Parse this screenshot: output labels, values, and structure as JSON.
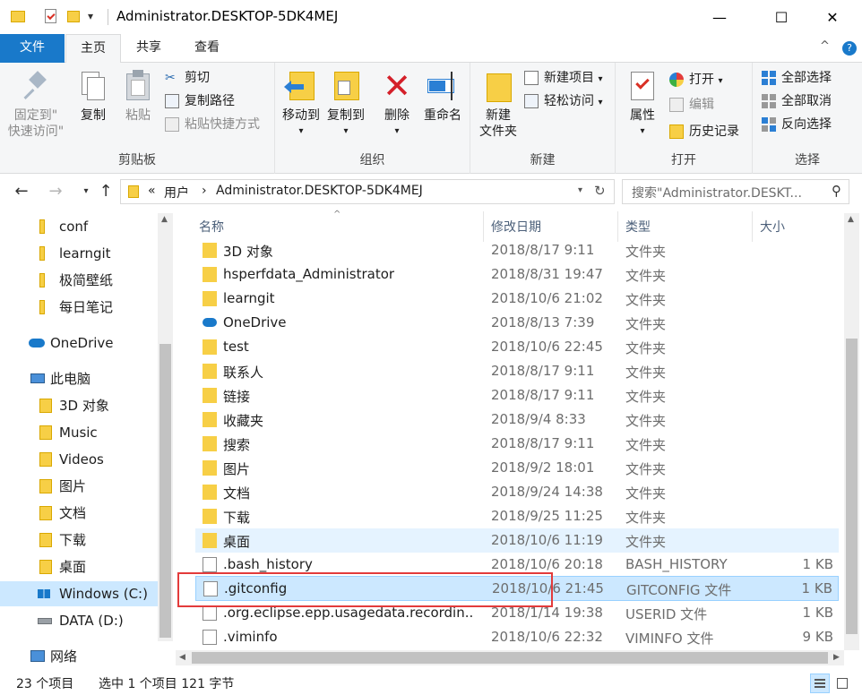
{
  "window": {
    "title": "Administrator.DESKTOP-5DK4MEJ",
    "minimize": "—",
    "maximize": "☐",
    "close": "✕",
    "qat_dropdown": "▾"
  },
  "ribbon_tabs": {
    "file": "文件",
    "home": "主页",
    "share": "共享",
    "view": "查看",
    "collapse": "^",
    "help": "?"
  },
  "ribbon": {
    "clipboard": {
      "label": "剪贴板",
      "pin": [
        "固定到\"",
        "快速访问\""
      ],
      "copy": "复制",
      "paste": "粘贴",
      "cut": "剪切",
      "copy_path": "复制路径",
      "paste_shortcut": "粘贴快捷方式"
    },
    "organize": {
      "label": "组织",
      "move_to": "移动到",
      "copy_to": "复制到",
      "delete": "删除",
      "rename": "重命名"
    },
    "new": {
      "label": "新建",
      "new_folder": [
        "新建",
        "文件夹"
      ],
      "new_item": "新建项目",
      "easy_access": "轻松访问"
    },
    "open": {
      "label": "打开",
      "properties": "属性",
      "open": "打开",
      "edit": "编辑",
      "history": "历史记录"
    },
    "select": {
      "label": "选择",
      "select_all": "全部选择",
      "select_none": "全部取消",
      "invert": "反向选择"
    }
  },
  "address": {
    "breadcrumb_prefix": "«",
    "crumb1": "用户",
    "sep": "›",
    "crumb2": "Administrator.DESKTOP-5DK4MEJ",
    "search_placeholder": "搜索\"Administrator.DESKT..."
  },
  "nav_pane": {
    "items": [
      {
        "label": "conf",
        "icon": "folder-icon"
      },
      {
        "label": "learngit",
        "icon": "folder-icon"
      },
      {
        "label": "极简壁纸",
        "icon": "folder-icon"
      },
      {
        "label": "每日笔记",
        "icon": "folder-icon"
      },
      {
        "label": "OneDrive",
        "icon": "onedrive-icon"
      },
      {
        "label": "此电脑",
        "icon": "computer-icon"
      },
      {
        "label": "3D 对象",
        "icon": "3d-objects-icon"
      },
      {
        "label": "Music",
        "icon": "music-icon"
      },
      {
        "label": "Videos",
        "icon": "videos-icon"
      },
      {
        "label": "图片",
        "icon": "pictures-icon"
      },
      {
        "label": "文档",
        "icon": "documents-icon"
      },
      {
        "label": "下载",
        "icon": "downloads-icon"
      },
      {
        "label": "桌面",
        "icon": "desktop-icon"
      },
      {
        "label": "Windows (C:)",
        "icon": "windows-drive-icon"
      },
      {
        "label": "DATA (D:)",
        "icon": "drive-icon"
      },
      {
        "label": "网络",
        "icon": "network-icon"
      }
    ]
  },
  "columns": {
    "name": "名称",
    "date": "修改日期",
    "type": "类型",
    "size": "大小"
  },
  "files": [
    {
      "name": "3D 对象",
      "date": "2018/8/17 9:11",
      "type": "文件夹",
      "size": ""
    },
    {
      "name": "hsperfdata_Administrator",
      "date": "2018/8/31 19:47",
      "type": "文件夹",
      "size": ""
    },
    {
      "name": "learngit",
      "date": "2018/10/6 21:02",
      "type": "文件夹",
      "size": ""
    },
    {
      "name": "OneDrive",
      "date": "2018/8/13 7:39",
      "type": "文件夹",
      "size": ""
    },
    {
      "name": "test",
      "date": "2018/10/6 22:45",
      "type": "文件夹",
      "size": ""
    },
    {
      "name": "联系人",
      "date": "2018/8/17 9:11",
      "type": "文件夹",
      "size": ""
    },
    {
      "name": "链接",
      "date": "2018/8/17 9:11",
      "type": "文件夹",
      "size": ""
    },
    {
      "name": "收藏夹",
      "date": "2018/9/4 8:33",
      "type": "文件夹",
      "size": ""
    },
    {
      "name": "搜索",
      "date": "2018/8/17 9:11",
      "type": "文件夹",
      "size": ""
    },
    {
      "name": "图片",
      "date": "2018/9/2 18:01",
      "type": "文件夹",
      "size": ""
    },
    {
      "name": "文档",
      "date": "2018/9/24 14:38",
      "type": "文件夹",
      "size": ""
    },
    {
      "name": "下载",
      "date": "2018/9/25 11:25",
      "type": "文件夹",
      "size": ""
    },
    {
      "name": "桌面",
      "date": "2018/10/6 11:19",
      "type": "文件夹",
      "size": ""
    },
    {
      "name": ".bash_history",
      "date": "2018/10/6 20:18",
      "type": "BASH_HISTORY",
      "size": "1 KB"
    },
    {
      "name": ".gitconfig",
      "date": "2018/10/6 21:45",
      "type": "GITCONFIG 文件",
      "size": "1 KB"
    },
    {
      "name": ".org.eclipse.epp.usagedata.recordin...",
      "date": "2018/1/14 19:38",
      "type": "USERID 文件",
      "size": "1 KB"
    },
    {
      "name": ".viminfo",
      "date": "2018/10/6 22:32",
      "type": "VIMINFO 文件",
      "size": "9 KB"
    }
  ],
  "status": {
    "count": "23 个项目",
    "selection": "选中 1 个项目  121 字节"
  },
  "colors": {
    "accent": "#1979ca",
    "selection": "#cce8ff",
    "hover": "#e5f3ff",
    "highlight_box": "#e33b3b",
    "folder": "#f7cf46"
  }
}
